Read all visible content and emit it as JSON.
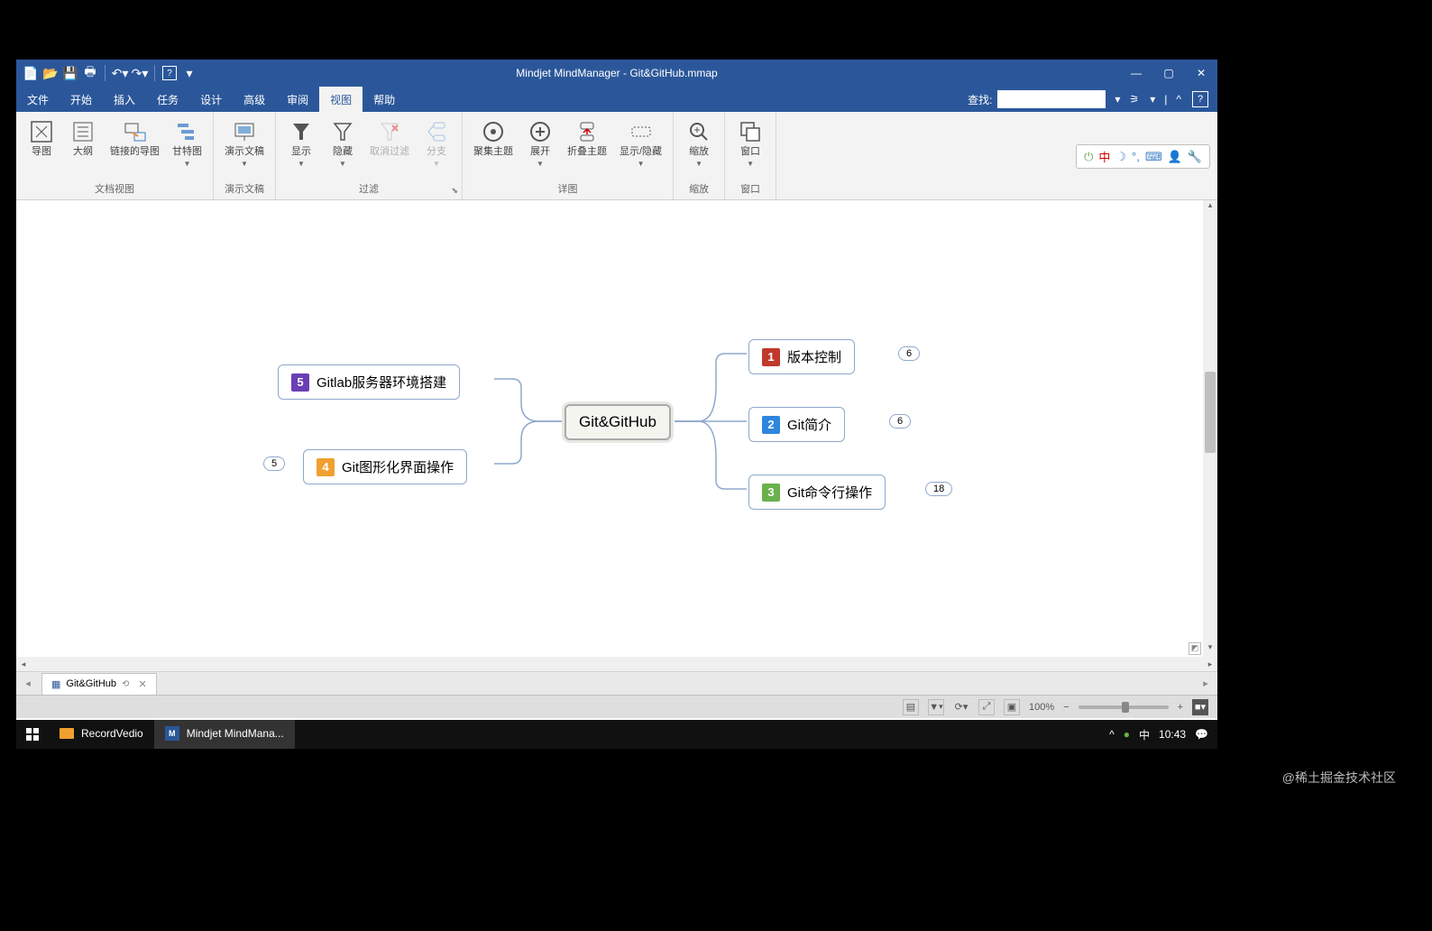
{
  "app": {
    "title": "Mindjet MindManager - Git&GitHub.mmap"
  },
  "window_controls": {
    "minimize": "—",
    "maximize": "▢",
    "close": "✕"
  },
  "menu": {
    "items": [
      "文件",
      "开始",
      "插入",
      "任务",
      "设计",
      "高级",
      "审阅",
      "视图",
      "帮助"
    ],
    "active_index": 7
  },
  "search": {
    "label": "查找:",
    "value": ""
  },
  "ribbon": {
    "groups": [
      {
        "label": "文档视图",
        "buttons": [
          {
            "label": "导图",
            "icon": "map-icon"
          },
          {
            "label": "大纲",
            "icon": "outline-icon"
          },
          {
            "label": "链接的导图",
            "icon": "linkedmap-icon"
          },
          {
            "label": "甘特图",
            "icon": "gantt-icon",
            "caret": true
          }
        ]
      },
      {
        "label": "演示文稿",
        "buttons": [
          {
            "label": "演示文稿",
            "icon": "presentation-icon",
            "caret": true
          }
        ]
      },
      {
        "label": "过滤",
        "launcher": true,
        "buttons": [
          {
            "label": "显示",
            "icon": "filter-show-icon",
            "caret": true
          },
          {
            "label": "隐藏",
            "icon": "filter-hide-icon",
            "caret": true
          },
          {
            "label": "取消过滤",
            "icon": "filter-cancel-icon",
            "disabled": true
          },
          {
            "label": "分支",
            "icon": "branch-icon",
            "caret": true,
            "disabled": true
          }
        ]
      },
      {
        "label": "详图",
        "buttons": [
          {
            "label": "聚集主题",
            "icon": "focus-icon"
          },
          {
            "label": "展开",
            "icon": "expand-icon",
            "caret": true
          },
          {
            "label": "折叠主题",
            "icon": "collapse-icon"
          },
          {
            "label": "显示/隐藏",
            "icon": "toggle-visibility-icon",
            "caret": true
          }
        ]
      },
      {
        "label": "缩放",
        "buttons": [
          {
            "label": "缩放",
            "icon": "zoom-icon",
            "caret": true
          }
        ]
      },
      {
        "label": "窗口",
        "buttons": [
          {
            "label": "窗口",
            "icon": "windows-icon",
            "caret": true
          }
        ]
      }
    ]
  },
  "ime": {
    "items": [
      "中",
      "☽",
      "°,",
      "⌨",
      "👤",
      "🔧"
    ]
  },
  "mindmap": {
    "root": "Git&GitHub",
    "left": [
      {
        "num": "5",
        "color": "#6a3fb5",
        "text": "Gitlab服务器环境搭建"
      },
      {
        "num": "4",
        "color": "#f0a030",
        "text": "Git图形化界面操作",
        "count": "5"
      }
    ],
    "right": [
      {
        "num": "1",
        "color": "#c0392b",
        "text": "版本控制",
        "count": "6"
      },
      {
        "num": "2",
        "color": "#2e86de",
        "text": "Git简介",
        "count": "6"
      },
      {
        "num": "3",
        "color": "#6ab04c",
        "text": "Git命令行操作",
        "count": "18"
      }
    ]
  },
  "tab": {
    "name": "Git&GitHub"
  },
  "status": {
    "zoom": "100%"
  },
  "taskbar": {
    "items": [
      {
        "label": "RecordVedio",
        "icon_color": "#f0a030"
      },
      {
        "label": "Mindjet MindMana...",
        "icon_color": "#2b579a",
        "active": true
      }
    ],
    "time": "10:43",
    "ime": "中"
  },
  "watermark": "@稀土掘金技术社区"
}
